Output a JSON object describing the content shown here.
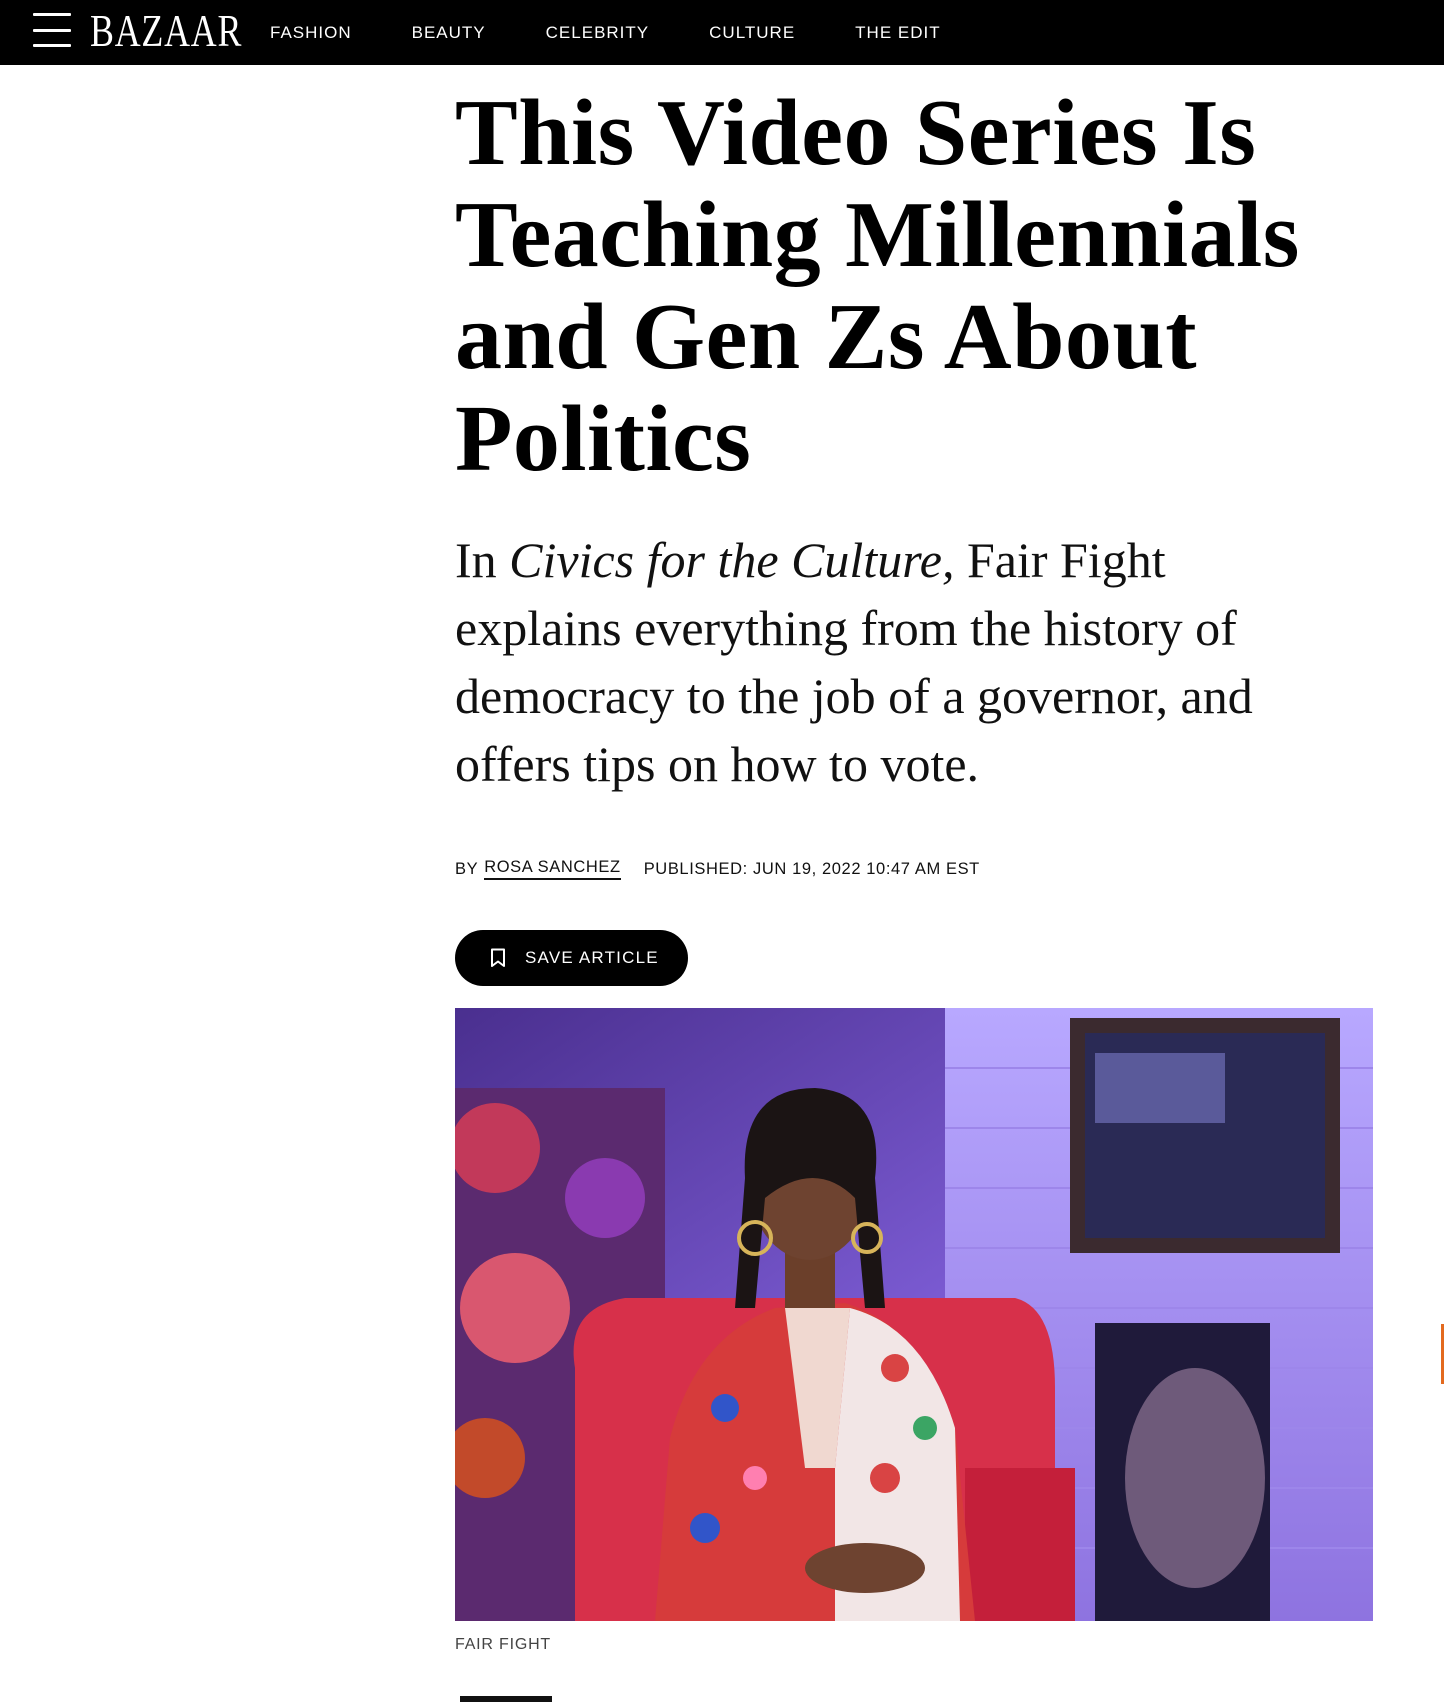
{
  "nav": {
    "logo": "BAZAAR",
    "items": [
      "FASHION",
      "BEAUTY",
      "CELEBRITY",
      "CULTURE",
      "THE EDIT"
    ]
  },
  "article": {
    "headline": "This Video Series Is Teaching Millennials and Gen Zs About Politics",
    "dek_prefix": "In ",
    "dek_italic": "Civics for the Culture,",
    "dek_rest": " Fair Fight explains everything from the history of democracy to the job of a governor, and offers tips on how to vote.",
    "byline_prefix": "BY",
    "author": "ROSA SANCHEZ",
    "published": "PUBLISHED: JUN 19, 2022 10:47 AM EST",
    "save_label": "SAVE ARTICLE",
    "image_caption": "FAIR FIGHT"
  },
  "colors": {
    "topbar": "#000000",
    "accent_scroll": "#e36a1f"
  },
  "icons": [
    "menu-icon",
    "bookmark-icon"
  ]
}
